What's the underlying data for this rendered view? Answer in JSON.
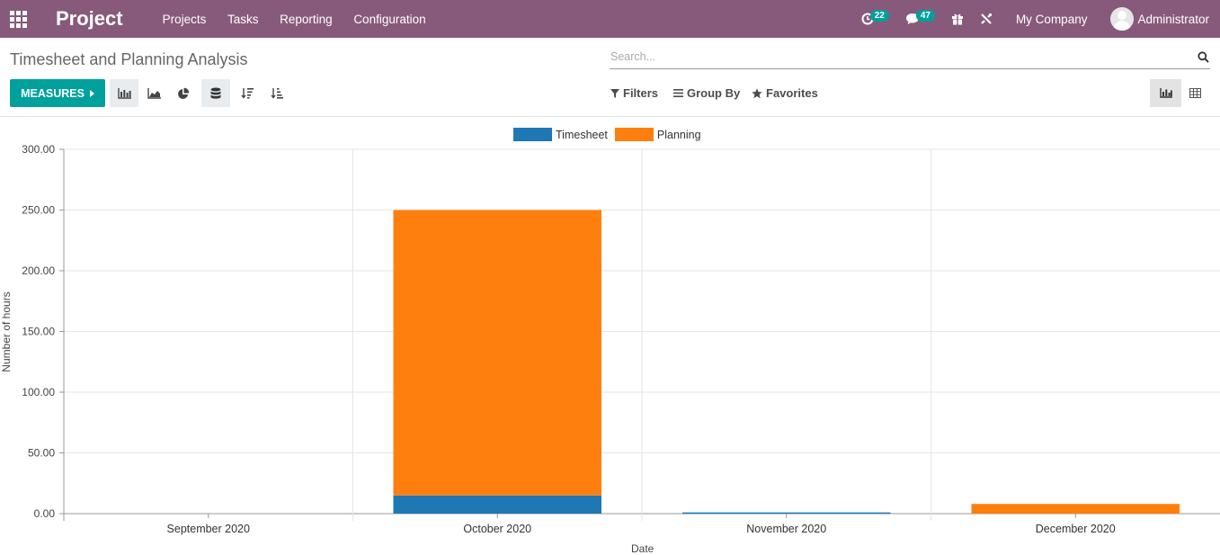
{
  "nav": {
    "brand": "Project",
    "menu": [
      "Projects",
      "Tasks",
      "Reporting",
      "Configuration"
    ],
    "activity_count": "22",
    "messages_count": "47",
    "company": "My Company",
    "user": "Administrator"
  },
  "control": {
    "breadcrumb": "Timesheet and Planning Analysis",
    "search_placeholder": "Search...",
    "measures_label": "MEASURES",
    "filters_label": "Filters",
    "groupby_label": "Group By",
    "favorites_label": "Favorites"
  },
  "colors": {
    "navbar": "#875a7b",
    "primary_button": "#00a09d",
    "timesheet": "#1f77b4",
    "planning": "#ff7f0e"
  },
  "chart_data": {
    "type": "bar",
    "stacked": true,
    "categories": [
      "September 2020",
      "October 2020",
      "November 2020",
      "December 2020"
    ],
    "series": [
      {
        "name": "Timesheet",
        "color": "#1f77b4",
        "values": [
          0,
          15,
          1,
          0
        ]
      },
      {
        "name": "Planning",
        "color": "#ff7f0e",
        "values": [
          0,
          235,
          0,
          8
        ]
      }
    ],
    "xlabel": "Date",
    "ylabel": "Number of hours",
    "ylim": [
      0,
      300
    ],
    "yticks": [
      "0.00",
      "50.00",
      "100.00",
      "150.00",
      "200.00",
      "250.00",
      "300.00"
    ],
    "grid": true,
    "legend": "top-center"
  }
}
